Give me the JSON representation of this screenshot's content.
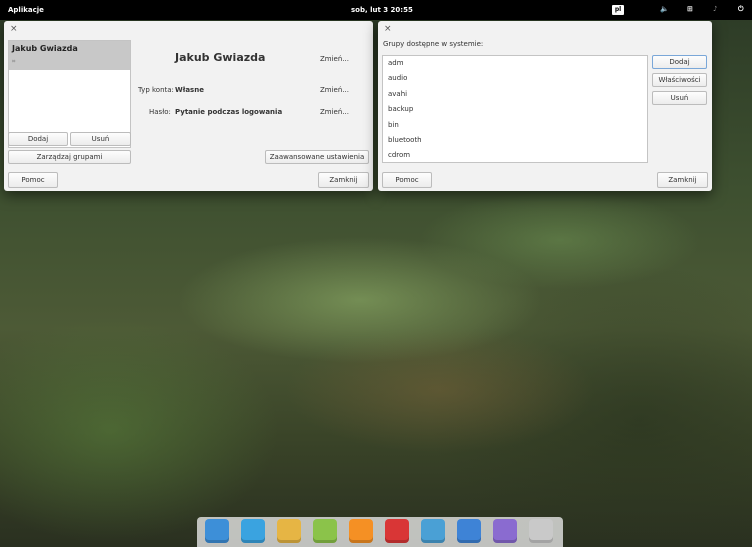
{
  "panel": {
    "apps_label": "Aplikacje",
    "clock": "sob, lut 3  20:55",
    "language": "pl"
  },
  "user_dialog": {
    "close": "×",
    "users": [
      {
        "name": "Jakub Gwiazda"
      }
    ],
    "display_name": "Jakub Gwiazda",
    "change_label": "Zmień...",
    "account_type_label": "Typ konta:",
    "account_type_value": "Własne",
    "password_label": "Hasło:",
    "password_value": "Pytanie podczas logowania",
    "add_button": "Dodaj",
    "remove_button": "Usuń",
    "manage_groups_button": "Zarządzaj grupami",
    "advanced_button": "Zaawansowane ustawienia",
    "help_button": "Pomoc",
    "close_button": "Zamknij"
  },
  "groups_dialog": {
    "close": "×",
    "header": "Grupy dostępne w systemie:",
    "groups": [
      "adm",
      "audio",
      "avahi",
      "backup",
      "bin",
      "bluetooth",
      "cdrom"
    ],
    "add_button": "Dodaj",
    "properties_button": "Właściwości",
    "remove_button": "Usuń",
    "help_button": "Pomoc",
    "close_button": "Zamknij"
  },
  "dock": {
    "apps": [
      {
        "icon": "multitasking-view-icon",
        "color": "#3d8fd8"
      },
      {
        "icon": "web-browser-icon",
        "color": "#3aa3e0"
      },
      {
        "icon": "mail-icon",
        "color": "#e6b544"
      },
      {
        "icon": "calendar-icon",
        "color": "#8bc34a"
      },
      {
        "icon": "music-icon",
        "color": "#f59024"
      },
      {
        "icon": "videos-icon",
        "color": "#d93636"
      },
      {
        "icon": "photos-icon",
        "color": "#4aa0d5"
      },
      {
        "icon": "settings-icon",
        "color": "#3e83d6"
      },
      {
        "icon": "appcenter-icon",
        "color": "#8a6bd0"
      },
      {
        "icon": "users-icon",
        "color": "#c9c9c9"
      }
    ]
  }
}
